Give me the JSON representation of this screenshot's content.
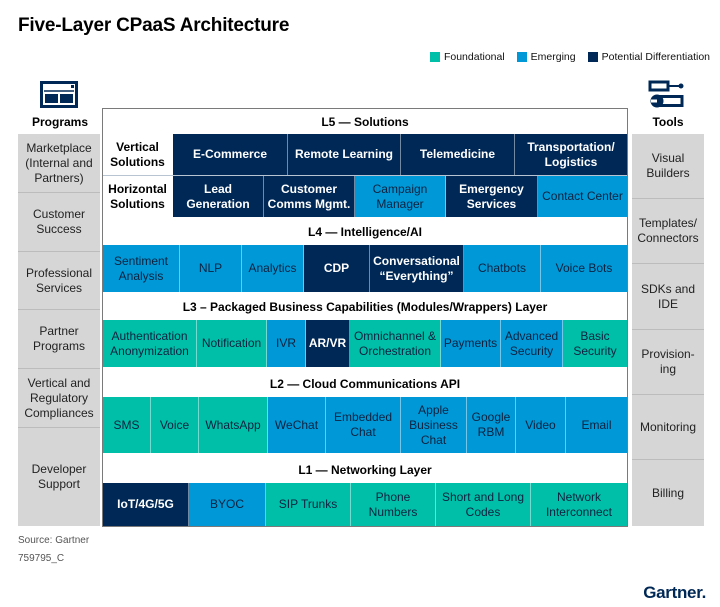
{
  "title": "Five-Layer CPaaS Architecture",
  "colors": {
    "foundational": "#00bfa8",
    "emerging": "#0098d6",
    "potential_differentiation": "#002856",
    "side_panel": "#d6d6d6"
  },
  "legend": [
    {
      "label": "Foundational",
      "color": "#00bfa8"
    },
    {
      "label": "Emerging",
      "color": "#0098d6"
    },
    {
      "label": "Potential Differentiation",
      "color": "#002856"
    }
  ],
  "programs": {
    "heading": "Programs",
    "icon": "browser-window-icon",
    "items": [
      "Marketplace (Internal and Partners)",
      "Customer Success",
      "Professional Services",
      "Partner Programs",
      "Vertical and Regulatory Compliances",
      "Developer Support"
    ]
  },
  "tools": {
    "heading": "Tools",
    "icon": "screwdriver-wrench-icon",
    "items": [
      "Visual Builders",
      "Templates/ Connectors",
      "SDKs and IDE",
      "Provision- ing",
      "Monitoring",
      "Billing"
    ]
  },
  "layers": {
    "l5": {
      "title": "L5 — Solutions",
      "vertical": {
        "label": "Vertical Solutions",
        "items": [
          {
            "label": "E-Commerce",
            "category": "potential_differentiation"
          },
          {
            "label": "Remote Learning",
            "category": "potential_differentiation"
          },
          {
            "label": "Telemedicine",
            "category": "potential_differentiation"
          },
          {
            "label": "Transportation/ Logistics",
            "category": "potential_differentiation"
          }
        ]
      },
      "horizontal": {
        "label": "Horizontal Solutions",
        "items": [
          {
            "label": "Lead Generation",
            "category": "potential_differentiation"
          },
          {
            "label": "Customer Comms Mgmt.",
            "category": "potential_differentiation"
          },
          {
            "label": "Campaign Manager",
            "category": "emerging"
          },
          {
            "label": "Emergency Services",
            "category": "potential_differentiation"
          },
          {
            "label": "Contact Center",
            "category": "emerging"
          }
        ]
      }
    },
    "l4": {
      "title": "L4 — Intelligence/AI",
      "items": [
        {
          "label": "Sentiment Analysis",
          "category": "emerging"
        },
        {
          "label": "NLP",
          "category": "emerging"
        },
        {
          "label": "Analytics",
          "category": "emerging"
        },
        {
          "label": "CDP",
          "category": "potential_differentiation"
        },
        {
          "label": "Conversational “Everything”",
          "category": "potential_differentiation"
        },
        {
          "label": "Chatbots",
          "category": "emerging"
        },
        {
          "label": "Voice Bots",
          "category": "emerging"
        }
      ]
    },
    "l3": {
      "title": "L3 – Packaged Business Capabilities (Modules/Wrappers) Layer",
      "items": [
        {
          "label": "Authentication Anonymization",
          "category": "foundational"
        },
        {
          "label": "Notification",
          "category": "foundational"
        },
        {
          "label": "IVR",
          "category": "emerging"
        },
        {
          "label": "AR/VR",
          "category": "potential_differentiation"
        },
        {
          "label": "Omnichannel & Orchestration",
          "category": "foundational"
        },
        {
          "label": "Payments",
          "category": "emerging"
        },
        {
          "label": "Advanced Security",
          "category": "emerging"
        },
        {
          "label": "Basic Security",
          "category": "foundational"
        }
      ]
    },
    "l2": {
      "title": "L2 — Cloud Communications API",
      "items": [
        {
          "label": "SMS",
          "category": "foundational"
        },
        {
          "label": "Voice",
          "category": "foundational"
        },
        {
          "label": "WhatsApp",
          "category": "foundational"
        },
        {
          "label": "WeChat",
          "category": "emerging"
        },
        {
          "label": "Embedded Chat",
          "category": "emerging"
        },
        {
          "label": "Apple Business Chat",
          "category": "emerging"
        },
        {
          "label": "Google RBM",
          "category": "emerging"
        },
        {
          "label": "Video",
          "category": "emerging"
        },
        {
          "label": "Email",
          "category": "emerging"
        }
      ]
    },
    "l1": {
      "title": "L1 — Networking Layer",
      "items": [
        {
          "label": "IoT/4G/5G",
          "category": "potential_differentiation"
        },
        {
          "label": "BYOC",
          "category": "emerging"
        },
        {
          "label": "SIP Trunks",
          "category": "foundational"
        },
        {
          "label": "Phone Numbers",
          "category": "foundational"
        },
        {
          "label": "Short and Long Codes",
          "category": "foundational"
        },
        {
          "label": "Network Interconnect",
          "category": "foundational"
        }
      ]
    }
  },
  "footer": {
    "source": "Source: Gartner",
    "id": "759795_C",
    "logo": "Gartner."
  }
}
